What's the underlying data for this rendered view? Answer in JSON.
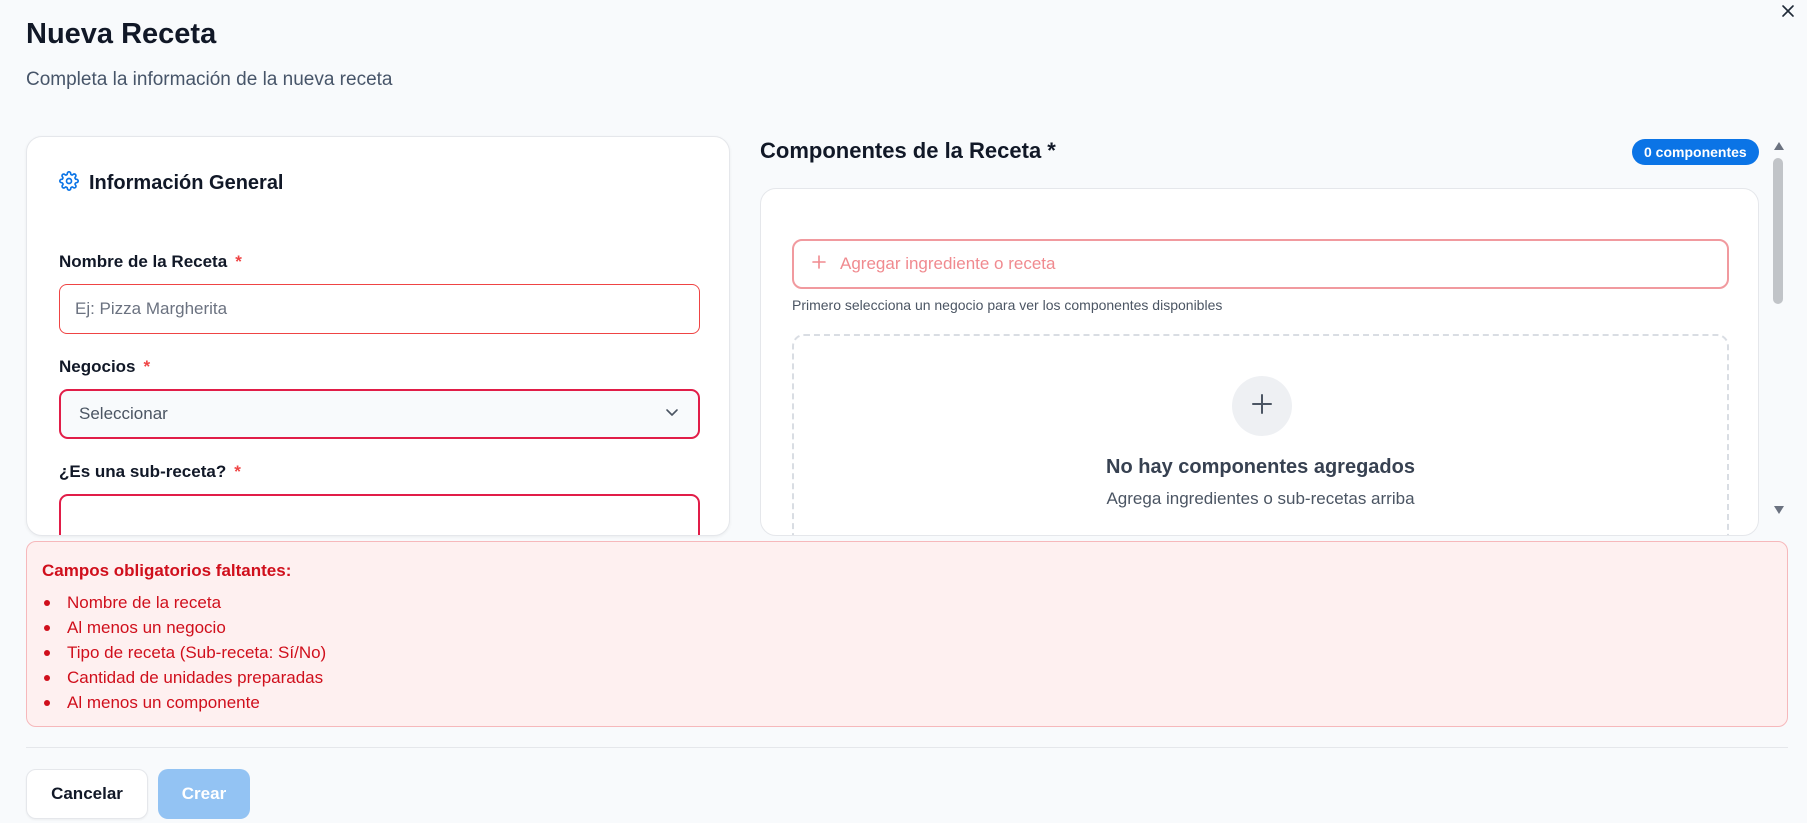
{
  "dialog": {
    "title": "Nueva Receta",
    "subtitle": "Completa la información de la nueva receta"
  },
  "general": {
    "heading": "Información General",
    "name_label": "Nombre de la Receta",
    "name_required": "*",
    "name_placeholder": "Ej: Pizza Margherita",
    "business_label": "Negocios",
    "business_required": "*",
    "business_value": "Seleccionar",
    "subrecipe_label": "¿Es una sub-receta?",
    "subrecipe_required": "*"
  },
  "components": {
    "title": "Componentes de la Receta *",
    "count_badge": "0 componentes",
    "add_placeholder": "Agregar ingrediente o receta",
    "hint": "Primero selecciona un negocio para ver los componentes disponibles",
    "empty_title": "No hay componentes agregados",
    "empty_subtitle": "Agrega ingredientes o sub-recetas arriba"
  },
  "errors": {
    "title": "Campos obligatorios faltantes:",
    "items": [
      "Nombre de la receta",
      "Al menos un negocio",
      "Tipo de receta (Sub-receta: Sí/No)",
      "Cantidad de unidades preparadas",
      "Al menos un componente"
    ]
  },
  "footer": {
    "cancel_label": "Cancelar",
    "create_label": "Crear"
  },
  "icons": {
    "close": "close-icon",
    "settings": "gear-icon",
    "chevron": "chevron-down-icon",
    "plus": "plus-icon"
  },
  "colors": {
    "accent": "#0b74e6",
    "error": "#d00f1c",
    "error_bg": "#fef0f0",
    "required": "#ef4444",
    "create_disabled": "#93c3f3"
  }
}
